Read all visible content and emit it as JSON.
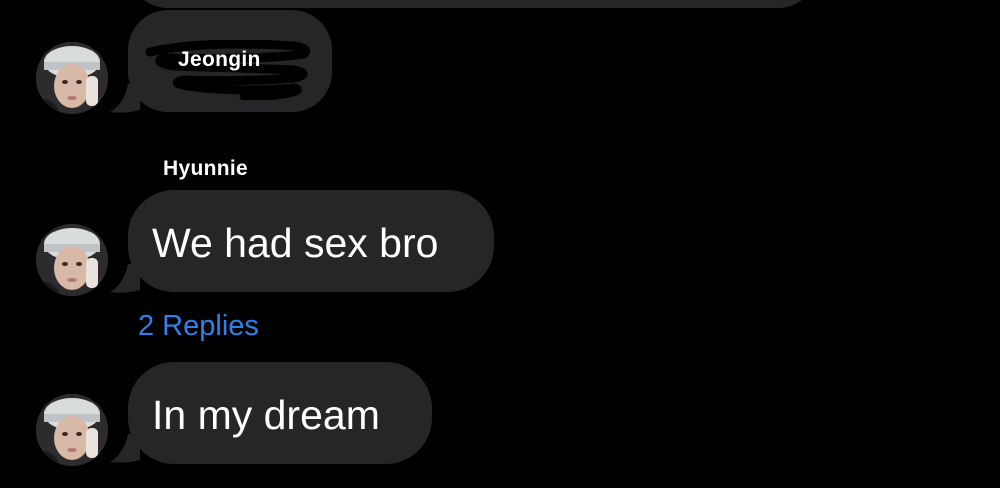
{
  "thread": {
    "reply_preview": {
      "author": "Jeongin"
    },
    "sender_name": "Hyunnie",
    "messages": [
      {
        "text": "We had sex bro"
      },
      {
        "text": "In my dream"
      }
    ],
    "replies_label": "2 Replies"
  },
  "colors": {
    "background": "#000000",
    "bubble": "#262628",
    "text": "#ffffff",
    "link": "#2f80ed"
  },
  "icons": {
    "avatar": "profile-photo-avatar"
  }
}
